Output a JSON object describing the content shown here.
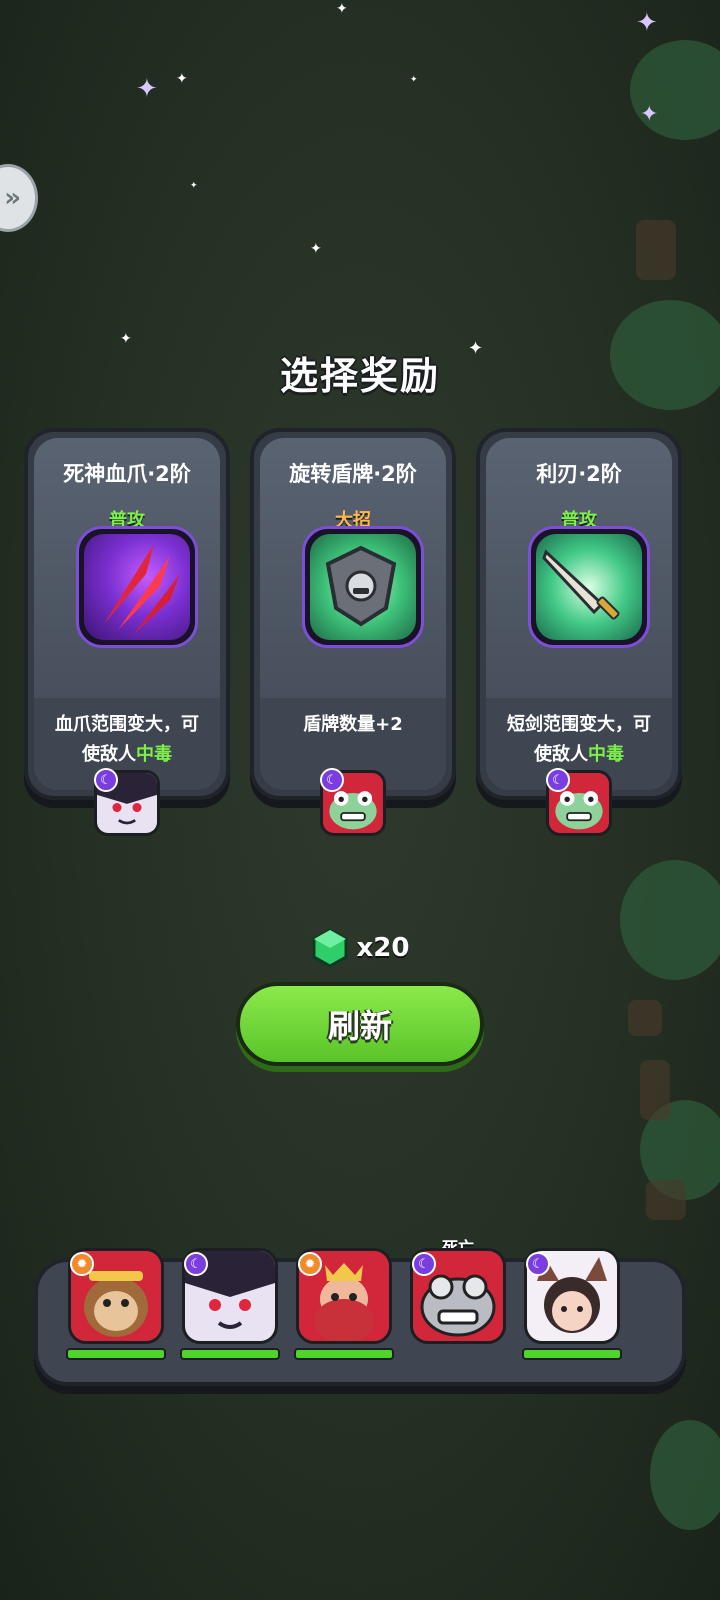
{
  "title": "选择奖励",
  "cards": [
    {
      "name": "死神血爪·2阶",
      "tag": "普攻",
      "desc_main": "血爪范围变大，可",
      "desc_prefix": "使敌人",
      "desc_highlight": "中毒",
      "icon": "blood-claw-icon",
      "owner": "vampire-hero-portrait",
      "owner_class": "purple"
    },
    {
      "name": "旋转盾牌·2阶",
      "tag": "大招",
      "desc_main": "盾牌数量+2",
      "icon": "spinning-shield-icon",
      "owner": "frog-king-hero-portrait",
      "owner_class": "purple"
    },
    {
      "name": "利刃·2阶",
      "tag": "普攻",
      "desc_main": "短剑范围变大，可",
      "desc_prefix": "使敌人",
      "desc_highlight": "中毒",
      "icon": "short-sword-icon",
      "owner": "frog-king-hero-portrait",
      "owner_class": "purple"
    }
  ],
  "gem": {
    "icon": "green-gem-icon",
    "count": "x20"
  },
  "refresh_label": "刷新",
  "team": [
    {
      "icon": "monkey-king-hero-portrait",
      "badge": "gear",
      "dead": false,
      "hp": 1.0
    },
    {
      "icon": "vampire-hero-portrait",
      "badge": "moon",
      "dead": false,
      "hp": 1.0
    },
    {
      "icon": "dwarf-king-hero-portrait",
      "badge": "gear",
      "dead": false,
      "hp": 1.0
    },
    {
      "icon": "frog-king-hero-portrait",
      "badge": "moon",
      "dead": true,
      "hp": 0.0,
      "status": "死亡"
    },
    {
      "icon": "cat-girl-hero-portrait",
      "badge": "moon",
      "dead": false,
      "hp": 1.0
    }
  ],
  "colors": {
    "accent_green": "#7ef04a",
    "accent_orange": "#ffb84a",
    "badge_purple": "#7a3ee0",
    "badge_orange": "#f08a2b"
  }
}
